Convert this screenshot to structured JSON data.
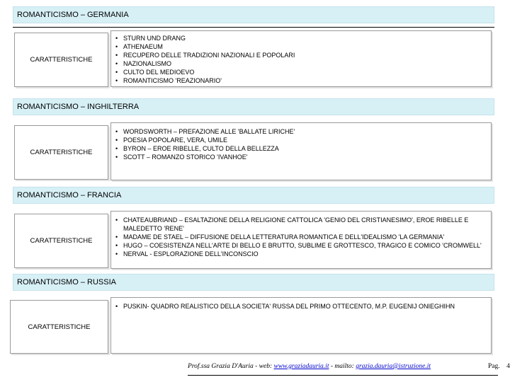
{
  "sections": [
    {
      "title": "ROMANTICISMO – GERMANIA",
      "label": "CARATTERISTICHE",
      "items": [
        "STURN UND DRANG",
        "ATHENAEUM",
        "RECUPERO DELLE TRADIZIONI NAZIONALI E POPOLARI",
        "NAZIONALISMO",
        "CULTO DEL MEDIOEVO",
        "ROMANTICISMO 'REAZIONARIO'"
      ]
    },
    {
      "title": "ROMANTICISMO – INGHILTERRA",
      "label": "CARATTERISTICHE",
      "items": [
        "WORDSWORTH – PREFAZIONE ALLE 'BALLATE LIRICHE'",
        "POESIA POPOLARE, VERA, UMILE",
        "BYRON – EROE RIBELLE, CULTO DELLA BELLEZZA",
        "SCOTT – ROMANZO STORICO 'IVANHOE'"
      ]
    },
    {
      "title": "ROMANTICISMO – FRANCIA",
      "label": "CARATTERISTICHE",
      "items": [
        "CHATEAUBRIAND – ESALTAZIONE DELLA RELIGIONE CATTOLICA 'GENIO DEL CRISTIANESIMO', EROE RIBELLE E MALEDETTO 'RENE'",
        "MADAME DE STAEL – DIFFUSIONE DELLA LETTERATURA ROMANTICA E DELL'IDEALISMO 'LA GERMANIA'",
        "HUGO – COESISTENZA NELL'ARTE DI BELLO E BRUTTO, SUBLIME E GROTTESCO, TRAGICO E COMICO 'CROMWELL'",
        "NERVAL -  ESPLORAZIONE DELL'INCONSCIO"
      ]
    },
    {
      "title": "ROMANTICISMO – RUSSIA",
      "label": "CARATTERISTICHE",
      "items": [
        "PUSKIN-  QUADRO REALISTICO DELLA SOCIETA' RUSSA DEL PRIMO OTTECENTO, M.P. EUGENIJ ONIEGHIHN"
      ]
    }
  ],
  "footer": {
    "author": "Prof.ssa Grazia D'Auria",
    "sep1": " - ",
    "web_label": "web: ",
    "web_link": "www.graziadauria.it",
    "sep2": " - mailto: ",
    "mail_link": "grazia.dauria@istruzione.it",
    "page_label": "Pag.",
    "page_number": "4"
  }
}
